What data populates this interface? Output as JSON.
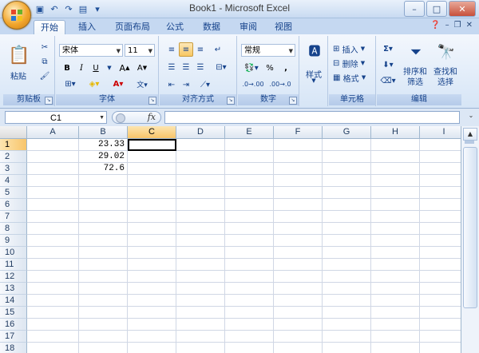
{
  "window": {
    "title": "Book1 - Microsoft Excel"
  },
  "tabs": [
    "开始",
    "插入",
    "页面布局",
    "公式",
    "数据",
    "审阅",
    "视图"
  ],
  "ribbon": {
    "clipboard": {
      "label": "剪贴板",
      "paste": "粘贴"
    },
    "font": {
      "label": "字体",
      "name": "宋体",
      "size": "11",
      "bold": "B",
      "italic": "I",
      "underline": "U"
    },
    "alignment": {
      "label": "对齐方式"
    },
    "number": {
      "label": "数字",
      "format": "常规",
      "percent": "%",
      "comma": ","
    },
    "styles": {
      "label": "样式"
    },
    "cells": {
      "label": "单元格",
      "insert": "插入",
      "delete": "删除",
      "format": "格式"
    },
    "editing": {
      "label": "编辑",
      "sort": "排序和\n筛选",
      "sort_l1": "排序和",
      "sort_l2": "筛选",
      "find_l1": "查找和",
      "find_l2": "选择"
    }
  },
  "formula_bar": {
    "name_box": "C1",
    "fx": "fx",
    "content": ""
  },
  "grid": {
    "columns": [
      "A",
      "B",
      "C",
      "D",
      "E",
      "F",
      "G",
      "H",
      "I"
    ],
    "rows": [
      "1",
      "2",
      "3",
      "4",
      "5",
      "6",
      "7",
      "8",
      "9",
      "10",
      "11",
      "12",
      "13",
      "14",
      "15",
      "16",
      "17",
      "18"
    ],
    "cells": {
      "B1": "23.33",
      "B2": "29.02",
      "B3": "72.6"
    },
    "active_cell": "C1"
  },
  "colors": {
    "ribbon": "#d6e5f6",
    "selected_header": "#f8c56a"
  }
}
